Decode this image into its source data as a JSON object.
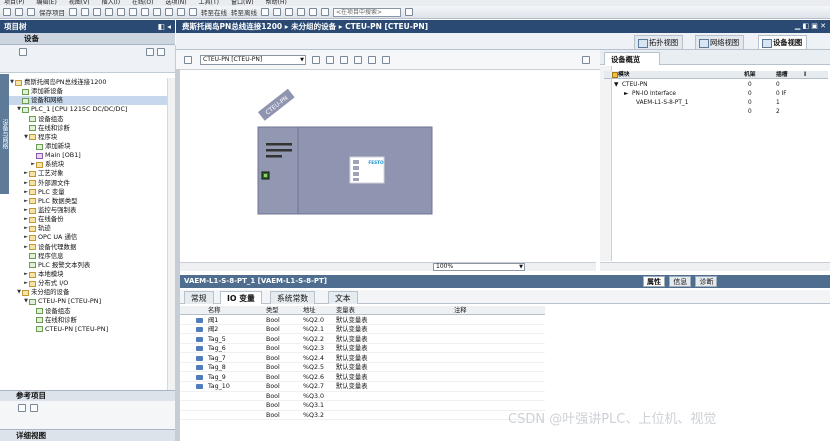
{
  "menubar": [
    "项目(P)",
    "编辑(E)",
    "视图(V)",
    "插入(I)",
    "在线(O)",
    "选项(N)",
    "工具(T)",
    "窗口(W)",
    "帮助(H)"
  ],
  "toolbar": {
    "save_label": "保存项目",
    "go_online": "转至在线",
    "go_offline": "转至离线",
    "search_placeholder": "<在项目中搜索>"
  },
  "project_panel": {
    "title": "项目树",
    "devices_header": "设备",
    "side_tab": "设备与网络",
    "tree": [
      {
        "label": "费斯托阀岛PN总线连接1200",
        "level": 0,
        "toggle": "▼",
        "icon": "fo"
      },
      {
        "label": "添加新设备",
        "level": 1,
        "toggle": "",
        "icon": "pl"
      },
      {
        "label": "设备和网络",
        "level": 1,
        "toggle": "",
        "icon": "pl",
        "selected": true
      },
      {
        "label": "PLC_1 [CPU 1215C DC/DC/DC]",
        "level": 1,
        "toggle": "▼",
        "icon": "pl"
      },
      {
        "label": "设备组态",
        "level": 2,
        "toggle": "",
        "icon": "pl"
      },
      {
        "label": "在线和诊断",
        "level": 2,
        "toggle": "",
        "icon": "pl"
      },
      {
        "label": "程序块",
        "level": 2,
        "toggle": "▼",
        "icon": "fo"
      },
      {
        "label": "添加新块",
        "level": 3,
        "toggle": "",
        "icon": "pl"
      },
      {
        "label": "Main [OB1]",
        "level": 3,
        "toggle": "",
        "icon": "ob"
      },
      {
        "label": "系统块",
        "level": 3,
        "toggle": "►",
        "icon": "fo"
      },
      {
        "label": "工艺对象",
        "level": 2,
        "toggle": "►",
        "icon": "fo"
      },
      {
        "label": "外部源文件",
        "level": 2,
        "toggle": "►",
        "icon": "fo"
      },
      {
        "label": "PLC 变量",
        "level": 2,
        "toggle": "►",
        "icon": "fo"
      },
      {
        "label": "PLC 数据类型",
        "level": 2,
        "toggle": "►",
        "icon": "fo"
      },
      {
        "label": "监控与强制表",
        "level": 2,
        "toggle": "►",
        "icon": "fo"
      },
      {
        "label": "在线备份",
        "level": 2,
        "toggle": "►",
        "icon": "fo"
      },
      {
        "label": "轨迹",
        "level": 2,
        "toggle": "►",
        "icon": "fo"
      },
      {
        "label": "OPC UA 通信",
        "level": 2,
        "toggle": "►",
        "icon": "fo"
      },
      {
        "label": "设备代理数据",
        "level": 2,
        "toggle": "►",
        "icon": "fo"
      },
      {
        "label": "程序信息",
        "level": 2,
        "toggle": "",
        "icon": "pl"
      },
      {
        "label": "PLC 报警文本列表",
        "level": 2,
        "toggle": "",
        "icon": "pl"
      },
      {
        "label": "本地模块",
        "level": 2,
        "toggle": "►",
        "icon": "fo"
      },
      {
        "label": "分布式 I/O",
        "level": 2,
        "toggle": "►",
        "icon": "fo"
      },
      {
        "label": "未分组的设备",
        "level": 1,
        "toggle": "▼",
        "icon": "fo"
      },
      {
        "label": "CTEU-PN [CTEU-PN]",
        "level": 2,
        "toggle": "▼",
        "icon": "pl"
      },
      {
        "label": "设备组态",
        "level": 3,
        "toggle": "",
        "icon": "pl"
      },
      {
        "label": "在线和诊断",
        "level": 3,
        "toggle": "",
        "icon": "pl"
      },
      {
        "label": "CTEU-PN [CTEU-PN]",
        "level": 3,
        "toggle": "",
        "icon": "pl"
      }
    ],
    "reference_header": "参考项目",
    "details_header": "详细视图"
  },
  "editor": {
    "breadcrumb": "费斯托阀岛PN总线连接1200 ▸ 未分组的设备 ▸ CTEU-PN [CTEU-PN]",
    "view_tabs": {
      "topology": "拓扑视图",
      "network": "网络视图",
      "device": "设备视图"
    },
    "device_select": "CTEU-PN [CTEU-PN]",
    "zoom": "100%",
    "device_label": "CTEU-PN",
    "module_brand": "FESTO"
  },
  "overview": {
    "tab": "设备概览",
    "headers": {
      "module": "模块",
      "rack": "机架",
      "slot": "插槽",
      "i": "I"
    },
    "rows": [
      {
        "module": "CTEU-PN",
        "rack": "0",
        "slot": "0",
        "toggle": "▼"
      },
      {
        "module": "PN-IO Interface",
        "rack": "0",
        "slot": "0 IF",
        "toggle": "►"
      },
      {
        "module": "VAEM-L1-S-8-PT_1",
        "rack": "0",
        "slot": "1",
        "toggle": ""
      },
      {
        "module": "",
        "rack": "0",
        "slot": "2",
        "toggle": ""
      }
    ]
  },
  "inspector": {
    "title": "VAEM-L1-S-8-PT_1 [VAEM-L1-S-8-PT]",
    "tabs": {
      "properties": "属性",
      "info": "信息",
      "diagnostics": "诊断"
    },
    "subtabs": {
      "general": "常规",
      "io_tags": "IO 变量",
      "system_constants": "系统常数",
      "texts": "文本"
    },
    "io_headers": {
      "name": "名称",
      "type": "类型",
      "address": "地址",
      "table": "变量表",
      "comment": "注释"
    },
    "io_rows": [
      {
        "name": "阀1",
        "type": "Bool",
        "address": "%Q2.0",
        "table": "默认变量表"
      },
      {
        "name": "阀2",
        "type": "Bool",
        "address": "%Q2.1",
        "table": "默认变量表"
      },
      {
        "name": "Tag_5",
        "type": "Bool",
        "address": "%Q2.2",
        "table": "默认变量表"
      },
      {
        "name": "Tag_6",
        "type": "Bool",
        "address": "%Q2.3",
        "table": "默认变量表"
      },
      {
        "name": "Tag_7",
        "type": "Bool",
        "address": "%Q2.4",
        "table": "默认变量表"
      },
      {
        "name": "Tag_8",
        "type": "Bool",
        "address": "%Q2.5",
        "table": "默认变量表"
      },
      {
        "name": "Tag_9",
        "type": "Bool",
        "address": "%Q2.6",
        "table": "默认变量表"
      },
      {
        "name": "Tag_10",
        "type": "Bool",
        "address": "%Q2.7",
        "table": "默认变量表"
      },
      {
        "name": "",
        "type": "Bool",
        "address": "%Q3.0",
        "table": ""
      },
      {
        "name": "",
        "type": "Bool",
        "address": "%Q3.1",
        "table": ""
      },
      {
        "name": "",
        "type": "Bool",
        "address": "%Q3.2",
        "table": ""
      }
    ]
  },
  "watermark": "CSDN @叶强讲PLC、上位机、视觉",
  "colors": {
    "title_bar": "#2b4a73",
    "module_body": "#8f95b0",
    "accent": "#4f6e8f"
  }
}
